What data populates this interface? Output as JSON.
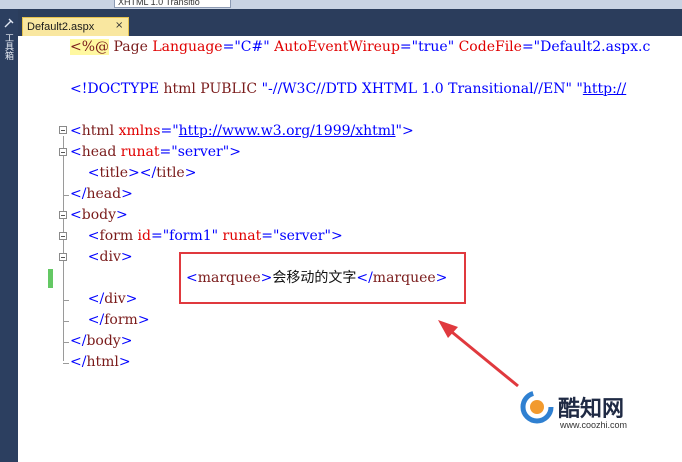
{
  "toolbar": {
    "doctype_combo": "XHTML 1.0 Transitio"
  },
  "toolbox": {
    "label": "工具箱"
  },
  "tabs": [
    {
      "label": "Default2.aspx",
      "close": "×"
    }
  ],
  "editor": {
    "lines": [
      [
        {
          "t": "<%@",
          "c": "tag directive"
        },
        {
          "t": " Page ",
          "c": "tag"
        },
        {
          "t": "Language",
          "c": "attr"
        },
        {
          "t": "=",
          "c": "br"
        },
        {
          "t": "\"C#\"",
          "c": "str"
        },
        {
          "t": " AutoEventWireup",
          "c": "attr"
        },
        {
          "t": "=",
          "c": "br"
        },
        {
          "t": "\"true\"",
          "c": "str"
        },
        {
          "t": " CodeFile",
          "c": "attr"
        },
        {
          "t": "=",
          "c": "br"
        },
        {
          "t": "\"Default2.aspx.c",
          "c": "str"
        }
      ],
      [
        {
          "t": "<!DOCTYPE ",
          "c": "br"
        },
        {
          "t": "html PUBLIC ",
          "c": "tag"
        },
        {
          "t": "\"-//W3C//DTD XHTML 1.0 Transitional//EN\"",
          "c": "str"
        },
        {
          "t": " ",
          "c": "txt"
        },
        {
          "t": "\"",
          "c": "str"
        },
        {
          "t": "http://",
          "c": "link"
        }
      ],
      [
        {
          "t": "<",
          "c": "br"
        },
        {
          "t": "html",
          "c": "tag"
        },
        {
          "t": " xmlns",
          "c": "attr"
        },
        {
          "t": "=",
          "c": "br"
        },
        {
          "t": "\"",
          "c": "str"
        },
        {
          "t": "http://www.w3.org/1999/xhtml",
          "c": "link"
        },
        {
          "t": "\"",
          "c": "str"
        },
        {
          "t": ">",
          "c": "br"
        }
      ],
      [
        {
          "t": "<",
          "c": "br"
        },
        {
          "t": "head",
          "c": "tag"
        },
        {
          "t": " runat",
          "c": "attr"
        },
        {
          "t": "=",
          "c": "br"
        },
        {
          "t": "\"server\"",
          "c": "str"
        },
        {
          "t": ">",
          "c": "br"
        }
      ],
      [
        {
          "t": "    <",
          "c": "br"
        },
        {
          "t": "title",
          "c": "tag"
        },
        {
          "t": "></",
          "c": "br"
        },
        {
          "t": "title",
          "c": "tag"
        },
        {
          "t": ">",
          "c": "br"
        }
      ],
      [
        {
          "t": "</",
          "c": "br"
        },
        {
          "t": "head",
          "c": "tag"
        },
        {
          "t": ">",
          "c": "br"
        }
      ],
      [
        {
          "t": "<",
          "c": "br"
        },
        {
          "t": "body",
          "c": "tag"
        },
        {
          "t": ">",
          "c": "br"
        }
      ],
      [
        {
          "t": "    <",
          "c": "br"
        },
        {
          "t": "form",
          "c": "tag"
        },
        {
          "t": " id",
          "c": "attr"
        },
        {
          "t": "=",
          "c": "br"
        },
        {
          "t": "\"form1\"",
          "c": "str"
        },
        {
          "t": " runat",
          "c": "attr"
        },
        {
          "t": "=",
          "c": "br"
        },
        {
          "t": "\"server\"",
          "c": "str"
        },
        {
          "t": ">",
          "c": "br"
        }
      ],
      [
        {
          "t": "    <",
          "c": "br"
        },
        {
          "t": "div",
          "c": "tag"
        },
        {
          "t": ">",
          "c": "br"
        }
      ],
      [
        {
          "t": "<",
          "c": "br"
        },
        {
          "t": "marquee",
          "c": "tag"
        },
        {
          "t": ">",
          "c": "br"
        },
        {
          "t": "会移动的文字",
          "c": "txt"
        },
        {
          "t": "</",
          "c": "br"
        },
        {
          "t": "marquee",
          "c": "tag"
        },
        {
          "t": ">",
          "c": "br"
        }
      ],
      [
        {
          "t": "    </",
          "c": "br"
        },
        {
          "t": "div",
          "c": "tag"
        },
        {
          "t": ">",
          "c": "br"
        }
      ],
      [
        {
          "t": "    </",
          "c": "br"
        },
        {
          "t": "form",
          "c": "tag"
        },
        {
          "t": ">",
          "c": "br"
        }
      ],
      [
        {
          "t": "</",
          "c": "br"
        },
        {
          "t": "body",
          "c": "tag"
        },
        {
          "t": ">",
          "c": "br"
        }
      ],
      [
        {
          "t": "</",
          "c": "br"
        },
        {
          "t": "html",
          "c": "tag"
        },
        {
          "t": ">",
          "c": "br"
        }
      ]
    ]
  },
  "colors": {
    "tag": "#7a1b1b",
    "attr": "#e00000",
    "string": "#0000ff",
    "highlight_box": "#e0393e",
    "tab_active": "#f9e7a0",
    "chrome_dark": "#2b3d5c",
    "change_marker": "#64c864"
  },
  "watermark": {
    "title": "酷知网",
    "url": "www.coozhi.com"
  }
}
